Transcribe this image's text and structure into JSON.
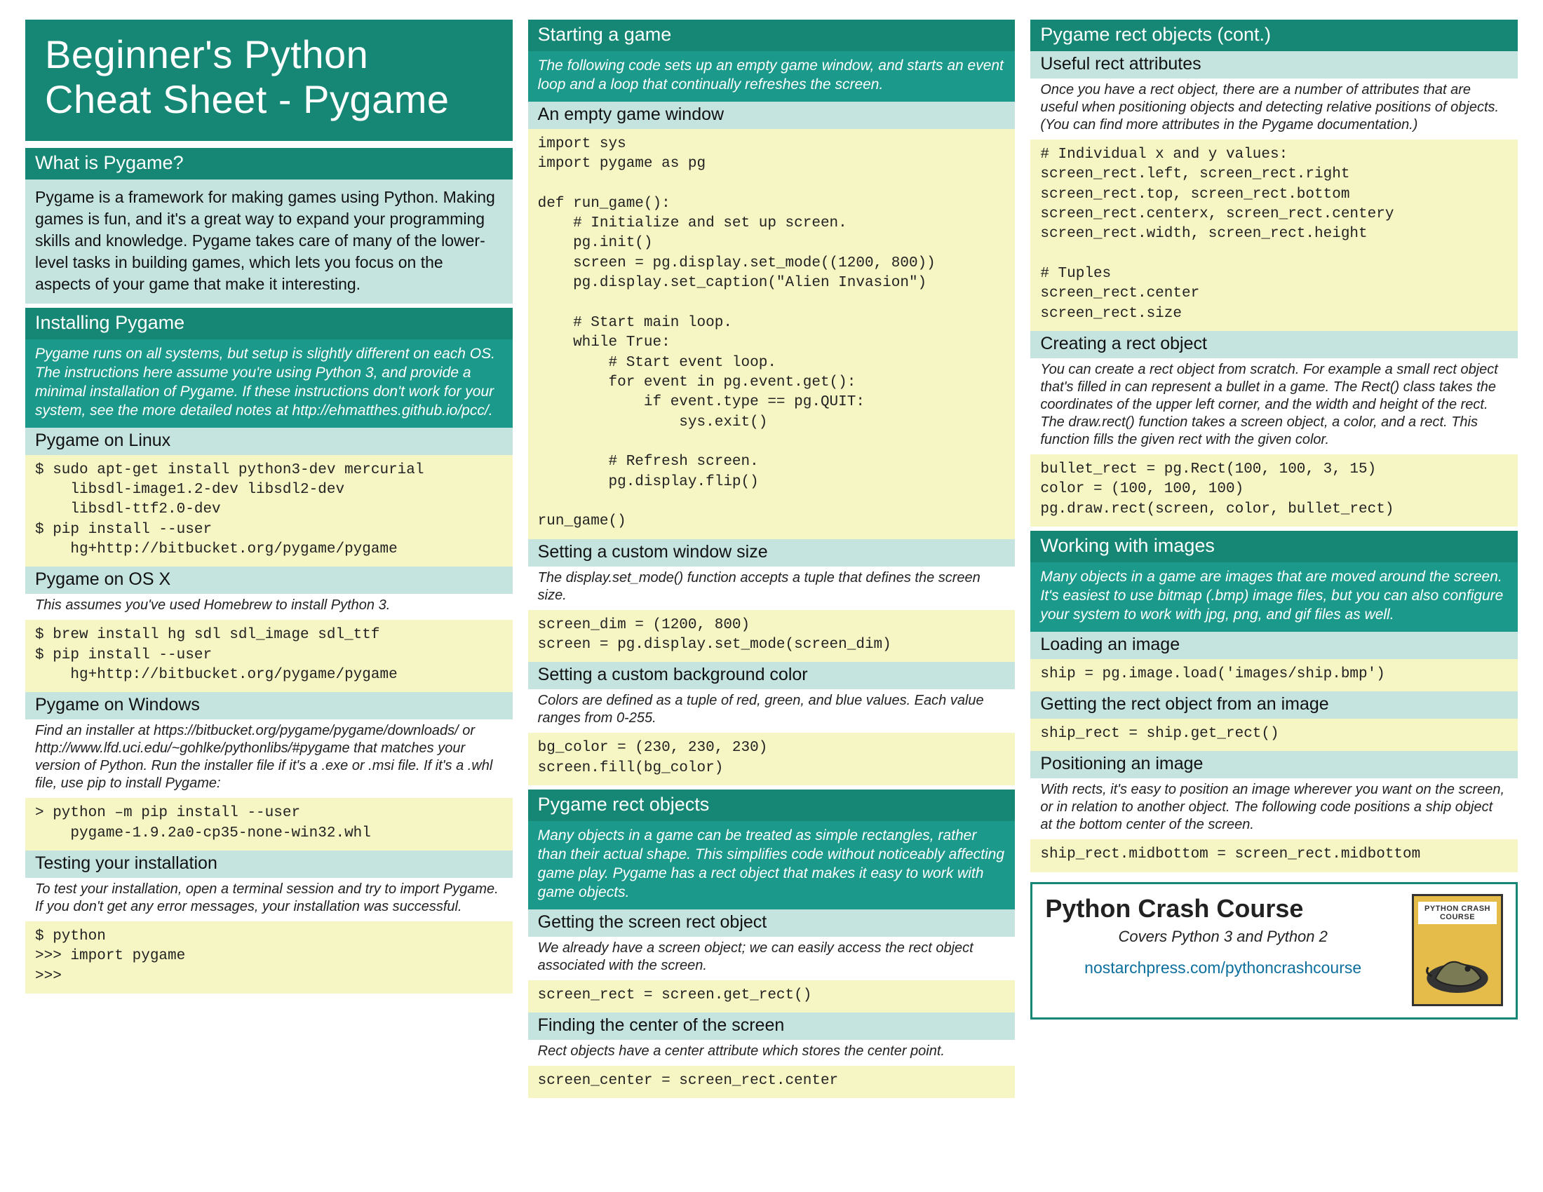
{
  "title_line1": "Beginner's Python",
  "title_line2": "Cheat Sheet - Pygame",
  "c1": {
    "what_head": "What is Pygame?",
    "what_body": "Pygame is a framework for making games using Python. Making games is fun, and it's a great way to expand your programming skills and knowledge. Pygame takes care of many of the lower-level tasks in building games, which lets you focus on the aspects of your game that make it interesting.",
    "install_head": "Installing Pygame",
    "install_desc": "Pygame runs on all systems, but setup is slightly different on each OS. The instructions here assume you're using Python 3, and provide a minimal installation of Pygame. If these instructions don't work for your system, see the more detailed notes at http://ehmatthes.github.io/pcc/.",
    "linux_head": "Pygame on Linux",
    "linux_code": "$ sudo apt-get install python3-dev mercurial\n    libsdl-image1.2-dev libsdl2-dev\n    libsdl-ttf2.0-dev\n$ pip install --user\n    hg+http://bitbucket.org/pygame/pygame",
    "osx_head": "Pygame on OS X",
    "osx_desc": "This assumes you've used Homebrew to install Python 3.",
    "osx_code": "$ brew install hg sdl sdl_image sdl_ttf\n$ pip install --user\n    hg+http://bitbucket.org/pygame/pygame",
    "win_head": "Pygame on Windows",
    "win_desc": "Find an installer at https://bitbucket.org/pygame/pygame/downloads/ or http://www.lfd.uci.edu/~gohlke/pythonlibs/#pygame that matches your version of Python. Run the installer file if it's a .exe or .msi file. If it's a .whl file, use pip to install Pygame:",
    "win_code": "> python –m pip install --user\n    pygame-1.9.2a0-cp35-none-win32.whl",
    "test_head": "Testing your installation",
    "test_desc": "To test your installation, open a terminal session and try to import Pygame. If you don't get any error messages, your installation was successful.",
    "test_code": "$ python\n>>> import pygame\n>>> "
  },
  "c2": {
    "start_head": "Starting a game",
    "start_desc": "The following code sets up an empty game window, and starts an event loop and a loop that continually refreshes the screen.",
    "empty_head": "An empty game window",
    "empty_code": "import sys\nimport pygame as pg\n\ndef run_game():\n    # Initialize and set up screen.\n    pg.init()\n    screen = pg.display.set_mode((1200, 800))\n    pg.display.set_caption(\"Alien Invasion\")\n\n    # Start main loop.\n    while True:\n        # Start event loop.\n        for event in pg.event.get():\n            if event.type == pg.QUIT:\n                sys.exit()\n\n        # Refresh screen.\n        pg.display.flip()\n\nrun_game()",
    "winsize_head": "Setting a custom window size",
    "winsize_desc": "The display.set_mode() function accepts a tuple that defines the screen size.",
    "winsize_code": "screen_dim = (1200, 800)\nscreen = pg.display.set_mode(screen_dim)",
    "bg_head": "Setting a custom background color",
    "bg_desc": "Colors are defined as a tuple of red, green, and blue values. Each value ranges from 0-255.",
    "bg_code": "bg_color = (230, 230, 230)\nscreen.fill(bg_color)",
    "rect_head": "Pygame rect objects",
    "rect_desc": "Many objects in a game can be treated as simple rectangles, rather than their actual shape. This simplifies code without noticeably affecting game play. Pygame has a rect object that makes it easy to work with game objects.",
    "getrect_head": "Getting the screen rect object",
    "getrect_desc": "We already have a screen object; we can easily access the rect object associated with the screen.",
    "getrect_code": "screen_rect = screen.get_rect()",
    "center_head": "Finding the center of the screen",
    "center_desc": "Rect objects have a center attribute which stores the center point.",
    "center_code": "screen_center = screen_rect.center"
  },
  "c3": {
    "cont_head": "Pygame rect objects (cont.)",
    "attrs_head": "Useful rect attributes",
    "attrs_desc": "Once you have a rect object, there are a number of attributes that are useful when positioning objects and detecting relative positions of objects. (You can find more attributes in the Pygame documentation.)",
    "attrs_code": "# Individual x and y values:\nscreen_rect.left, screen_rect.right\nscreen_rect.top, screen_rect.bottom\nscreen_rect.centerx, screen_rect.centery\nscreen_rect.width, screen_rect.height\n\n# Tuples\nscreen_rect.center\nscreen_rect.size",
    "create_head": "Creating a rect object",
    "create_desc": "You can create a rect object from scratch. For example a small rect object that's filled in can represent a bullet in a game. The Rect() class takes the coordinates of the upper left corner, and the width and height of the rect. The draw.rect() function takes a screen object, a color, and a rect. This function fills the given rect with the given color.",
    "create_code": "bullet_rect = pg.Rect(100, 100, 3, 15)\ncolor = (100, 100, 100)\npg.draw.rect(screen, color, bullet_rect)",
    "img_head": "Working with images",
    "img_desc": "Many objects in a game are images that are moved around the screen. It's easiest to use bitmap (.bmp) image files, but you can also configure your system to work with jpg, png, and gif files as well.",
    "load_head": "Loading an image",
    "load_code": "ship = pg.image.load('images/ship.bmp')",
    "getimg_head": "Getting the rect object from an image",
    "getimg_code": "ship_rect = ship.get_rect()",
    "pos_head": "Positioning an image",
    "pos_desc": "With rects, it's easy to position an image wherever you want on the screen, or in relation to another object. The following code positions a ship object at the bottom center of the screen.",
    "pos_code": "ship_rect.midbottom = screen_rect.midbottom"
  },
  "footer": {
    "title": "Python Crash Course",
    "sub": "Covers Python 3 and Python 2",
    "link": "nostarchpress.com/pythoncrashcourse",
    "book_label": "PYTHON CRASH COURSE"
  }
}
